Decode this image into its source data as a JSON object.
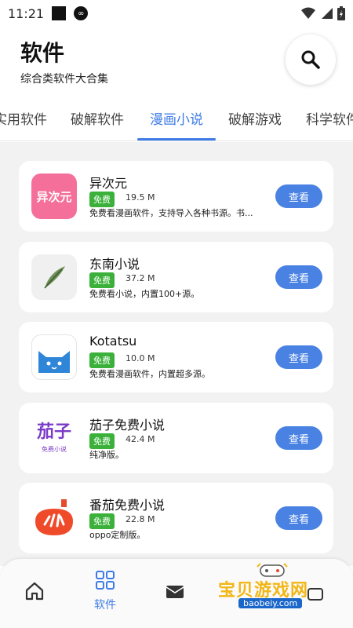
{
  "status_bar": {
    "time": "11:21"
  },
  "header": {
    "title": "软件",
    "subtitle": "综合类软件大合集"
  },
  "tabs": [
    {
      "label": "实用软件"
    },
    {
      "label": "破解软件"
    },
    {
      "label": "漫画小说",
      "active": true
    },
    {
      "label": "破解游戏"
    },
    {
      "label": "科学软件"
    }
  ],
  "apps": [
    {
      "name": "异次元",
      "badge": "免费",
      "size": "19.5 M",
      "desc": "免费看漫画软件，支持导入各种书源。书...",
      "button": "查看",
      "icon_text": "异次元"
    },
    {
      "name": "东南小说",
      "badge": "免费",
      "size": "37.2 M",
      "desc": "免费看小说，内置100+源。",
      "button": "查看"
    },
    {
      "name": "Kotatsu",
      "badge": "免费",
      "size": "10.0 M",
      "desc": "免费看漫画软件，内置超多源。",
      "button": "查看"
    },
    {
      "name": "茄子免费小说",
      "badge": "免费",
      "size": "42.4 M",
      "desc": "纯净版。",
      "button": "查看",
      "icon_text": "茄子",
      "icon_subtext": "免费小说"
    },
    {
      "name": "番茄免费小说",
      "badge": "免费",
      "size": "22.8 M",
      "desc": "oppo定制版。",
      "button": "查看"
    }
  ],
  "bottom_nav": {
    "active_label": "软件"
  },
  "watermark": {
    "text": "宝贝游戏网",
    "url": "baobeiy.com"
  },
  "colors": {
    "accent": "#3d7be6",
    "badge": "#3bb13b",
    "button": "#4a82e3"
  }
}
